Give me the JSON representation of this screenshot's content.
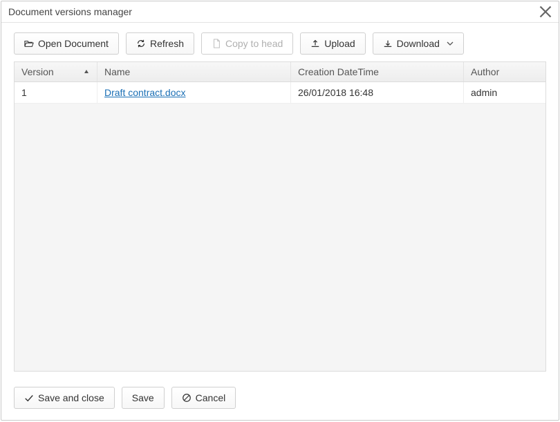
{
  "title": "Document versions manager",
  "toolbar": {
    "open_document": "Open Document",
    "refresh": "Refresh",
    "copy_to_head": "Copy to head",
    "upload": "Upload",
    "download": "Download"
  },
  "grid": {
    "headers": {
      "version": "Version",
      "name": "Name",
      "creation_datetime": "Creation DateTime",
      "author": "Author"
    },
    "rows": [
      {
        "version": "1",
        "name": "Draft contract.docx",
        "creation_datetime": "26/01/2018 16:48",
        "author": "admin"
      }
    ]
  },
  "footer": {
    "save_and_close": "Save and close",
    "save": "Save",
    "cancel": "Cancel"
  }
}
